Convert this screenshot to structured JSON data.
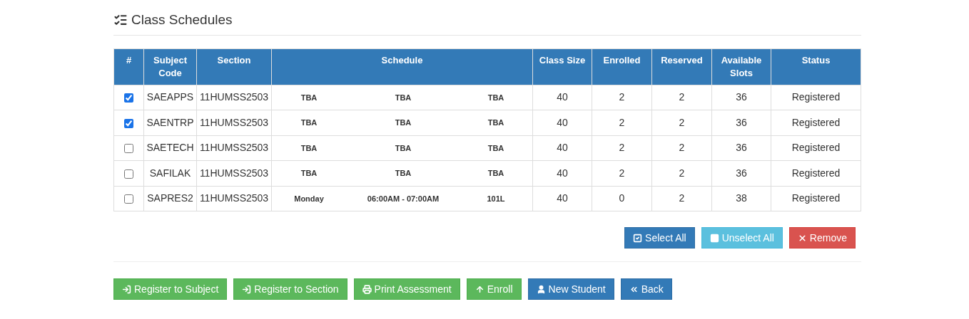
{
  "title": "Class Schedules",
  "table": {
    "columns": [
      "#",
      "Subject Code",
      "Section",
      "Schedule",
      "Class Size",
      "Enrolled",
      "Reserved",
      "Available Slots",
      "Status"
    ],
    "rows": [
      {
        "checked": true,
        "subject_code": "SAEAPPS",
        "section": "11HUMSS2503",
        "day": "TBA",
        "time": "TBA",
        "room": "TBA",
        "class_size": "40",
        "enrolled": "2",
        "reserved": "2",
        "available": "36",
        "status": "Registered"
      },
      {
        "checked": true,
        "subject_code": "SAENTRP",
        "section": "11HUMSS2503",
        "day": "TBA",
        "time": "TBA",
        "room": "TBA",
        "class_size": "40",
        "enrolled": "2",
        "reserved": "2",
        "available": "36",
        "status": "Registered"
      },
      {
        "checked": false,
        "subject_code": "SAETECH",
        "section": "11HUMSS2503",
        "day": "TBA",
        "time": "TBA",
        "room": "TBA",
        "class_size": "40",
        "enrolled": "2",
        "reserved": "2",
        "available": "36",
        "status": "Registered"
      },
      {
        "checked": false,
        "subject_code": "SAFILAK",
        "section": "11HUMSS2503",
        "day": "TBA",
        "time": "TBA",
        "room": "TBA",
        "class_size": "40",
        "enrolled": "2",
        "reserved": "2",
        "available": "36",
        "status": "Registered"
      },
      {
        "checked": false,
        "subject_code": "SAPRES2",
        "section": "11HUMSS2503",
        "day": "Monday",
        "time": "06:00AM - 07:00AM",
        "room": "101L",
        "class_size": "40",
        "enrolled": "0",
        "reserved": "2",
        "available": "38",
        "status": "Registered"
      }
    ]
  },
  "selection_buttons": [
    {
      "label": "Select All",
      "kind": "primary"
    },
    {
      "label": "Unselect All",
      "kind": "info"
    },
    {
      "label": "Remove",
      "kind": "danger"
    }
  ],
  "action_buttons": [
    {
      "label": "Register to Subject",
      "kind": "success"
    },
    {
      "label": "Register to Section",
      "kind": "success"
    },
    {
      "label": "Print Assessment",
      "kind": "success"
    },
    {
      "label": "Enroll",
      "kind": "success"
    },
    {
      "label": "New Student",
      "kind": "primary"
    },
    {
      "label": "Back",
      "kind": "primary"
    }
  ]
}
